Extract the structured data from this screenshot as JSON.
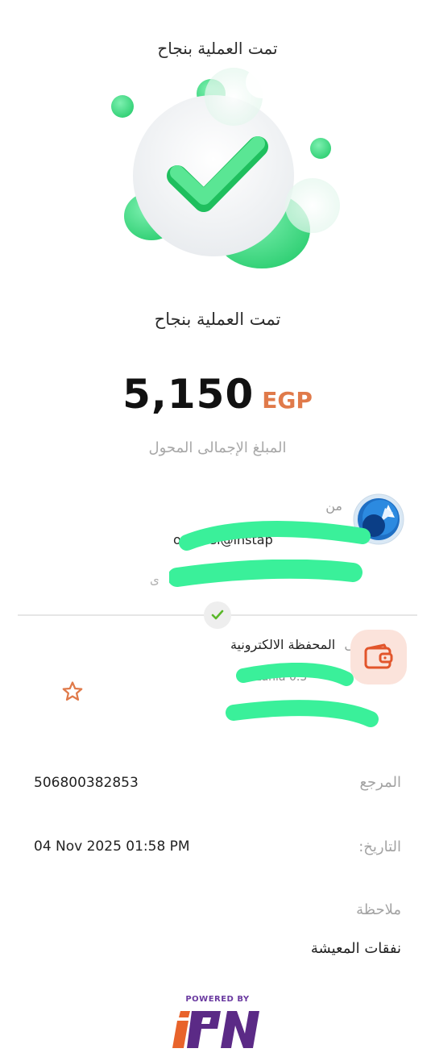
{
  "header": {
    "title": "تمت العملية بنجاح"
  },
  "status": {
    "title": "تمت العملية بنجاح"
  },
  "amount": {
    "value": "5,150",
    "currency": "EGP",
    "caption": "المبلغ الإجمالى المحول"
  },
  "sender": {
    "label": "من",
    "email_visible": "os              lassi@instap",
    "sub_visible": "ى"
  },
  "receiver": {
    "prefix": "إلى",
    "label": "المحفظة الالكترونية",
    "name_visible": "Zania 0.5"
  },
  "details": {
    "reference_label": "المرجع",
    "reference_value": "506800382853",
    "date_label": "التاريخ:",
    "date_value": "04 Nov 2025 01:58 PM",
    "note_label": "ملاحظة",
    "note_value": "نفقات المعيشة"
  },
  "footer": {
    "powered_by": "POWERED BY"
  },
  "colors": {
    "accent": "#e07a4a",
    "success": "#3ddc84",
    "wallet_bg": "#fbe3db",
    "redaction": "#3af09a"
  },
  "icons": [
    "success-check-icon",
    "bank-logo-icon",
    "wallet-icon",
    "star-icon",
    "small-check-icon",
    "ipn-logo"
  ]
}
